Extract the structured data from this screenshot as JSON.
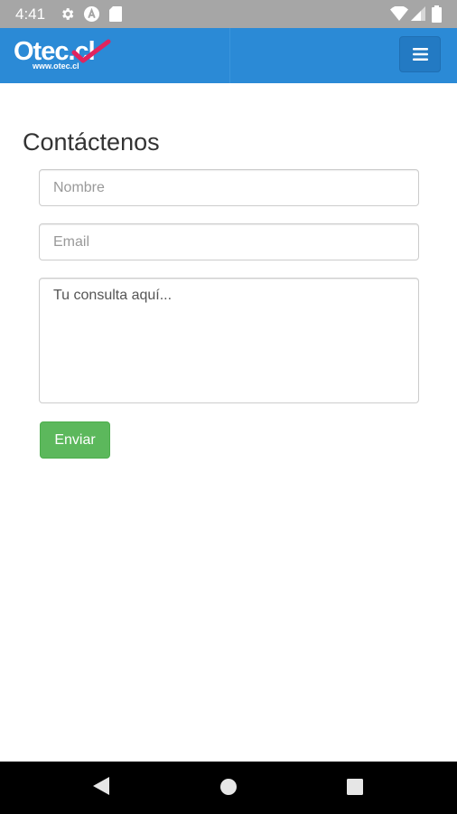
{
  "status_bar": {
    "time": "4:41",
    "left_icons": [
      "gear-icon",
      "accessibility-a-icon",
      "sd-card-icon"
    ],
    "right_icons": [
      "wifi-icon",
      "cell-signal-icon",
      "battery-icon"
    ]
  },
  "header": {
    "logo_text": "Otec.cl",
    "logo_url": "www.otec.cl",
    "menu_icon": "hamburger-menu-icon",
    "colors": {
      "background": "#2b8ad6",
      "check_mark": "#e0245e"
    }
  },
  "contact": {
    "title": "Contáctenos",
    "name_placeholder": "Nombre",
    "email_placeholder": "Email",
    "message_placeholder": "Tu consulta aquí...",
    "submit_label": "Enviar",
    "submit_color": "#5cb85c"
  },
  "nav_bar": {
    "buttons": [
      "back-icon",
      "home-icon",
      "recents-icon"
    ]
  }
}
